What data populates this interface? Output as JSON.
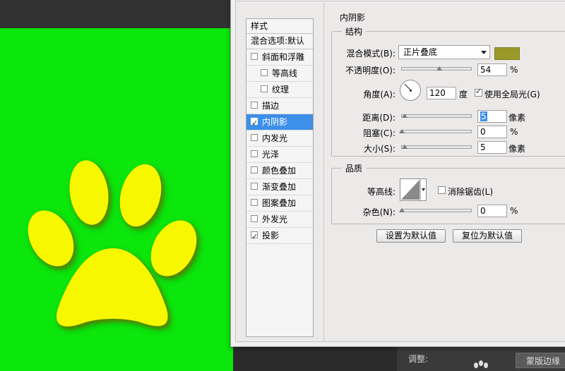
{
  "canvas": {
    "background_color": "#0be60b",
    "paw_color": "#f7f700"
  },
  "adjust_panel": {
    "label": "调整:",
    "mask_button": "蒙版边缘"
  },
  "styles_panel": {
    "header": "样式",
    "blend_options": "混合选项:默认",
    "items": [
      {
        "label": "斜面和浮雕",
        "checked": false,
        "indent": false,
        "active": false
      },
      {
        "label": "等高线",
        "checked": false,
        "indent": true,
        "active": false
      },
      {
        "label": "纹理",
        "checked": false,
        "indent": true,
        "active": false
      },
      {
        "label": "描边",
        "checked": false,
        "indent": false,
        "active": false
      },
      {
        "label": "内阴影",
        "checked": true,
        "indent": false,
        "active": true
      },
      {
        "label": "内发光",
        "checked": false,
        "indent": false,
        "active": false
      },
      {
        "label": "光泽",
        "checked": false,
        "indent": false,
        "active": false
      },
      {
        "label": "颜色叠加",
        "checked": false,
        "indent": false,
        "active": false
      },
      {
        "label": "渐变叠加",
        "checked": false,
        "indent": false,
        "active": false
      },
      {
        "label": "图案叠加",
        "checked": false,
        "indent": false,
        "active": false
      },
      {
        "label": "外发光",
        "checked": false,
        "indent": false,
        "active": false
      },
      {
        "label": "投影",
        "checked": true,
        "indent": false,
        "active": false
      }
    ]
  },
  "inner_shadow": {
    "title": "内阴影",
    "structure": {
      "title": "结构",
      "blend_mode_label": "混合模式(B):",
      "blend_mode_value": "正片叠底",
      "shadow_color": "#9a9a2a",
      "opacity_label": "不透明度(O):",
      "opacity_value": "54",
      "opacity_unit": "%",
      "opacity_fraction": 0.54,
      "angle_label": "角度(A):",
      "angle_value": "120",
      "angle_unit": "度",
      "global_light_label": "使用全局光(G)",
      "global_light_checked": true,
      "distance_label": "距离(D):",
      "distance_value": "5",
      "distance_unit": "像素",
      "choke_label": "阻塞(C):",
      "choke_value": "0",
      "choke_unit": "%",
      "size_label": "大小(S):",
      "size_value": "5",
      "size_unit": "像素"
    },
    "quality": {
      "title": "品质",
      "contour_label": "等高线:",
      "anti_alias_label": "消除锯齿(L)",
      "anti_alias_checked": false,
      "noise_label": "杂色(N):",
      "noise_value": "0",
      "noise_unit": "%"
    },
    "buttons": {
      "set_default": "设置为默认值",
      "reset_default": "复位为默认值"
    }
  }
}
